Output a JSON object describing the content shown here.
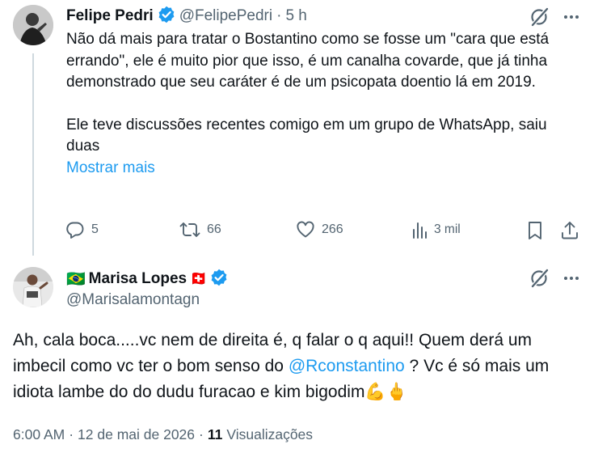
{
  "tweet": {
    "author_name": "Felipe Pedri",
    "author_handle": "@FelipePedri",
    "separator": "·",
    "time_ago": "5 h",
    "text_p1": "Não dá mais para tratar o Bostantino como se fosse um \"cara que está errando\", ele é muito pior que isso, é um canalha covarde, que já tinha demonstrado que seu caráter é de um psicopata doentio lá em 2019.",
    "text_p2": "Ele teve discussões recentes comigo em um grupo de WhatsApp, saiu duas",
    "show_more": "Mostrar mais",
    "actions": {
      "replies": "5",
      "reposts": "66",
      "likes": "266",
      "views": "3 mil"
    }
  },
  "reply": {
    "flag": "🇧🇷",
    "author_name": "Marisa Lopes",
    "name_emoji": "🇨🇭",
    "author_handle": "@Marisalamontagn",
    "text_before": "Ah, cala boca.....vc nem de direita é, q falar o q aqui!! Quem derá um imbecil como vc ter o bom senso do ",
    "mention": "@Rconstantino",
    "text_after": " ? Vc é só mais um idiota lambe do do dudu furacao e kim bigodim💪🖕",
    "time": "6:00 AM",
    "dot": "·",
    "date": "12 de mai de 2026",
    "views_count": "11",
    "views_label": "Visualizações"
  },
  "colors": {
    "text": "#0f1419",
    "secondary": "#536471",
    "link": "#1d9bf0",
    "verified": "#1d9bf0",
    "divider": "#eff3f4"
  },
  "icons": [
    "verified-badge-icon",
    "grok-icon",
    "more-icon",
    "reply-icon",
    "repost-icon",
    "like-icon",
    "views-icon",
    "bookmark-icon",
    "share-icon"
  ]
}
